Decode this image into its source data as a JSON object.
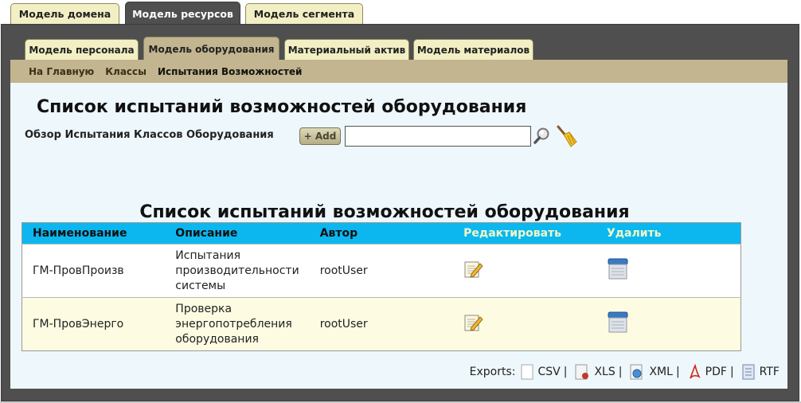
{
  "top_tabs": [
    {
      "label": "Модель домена",
      "active": false
    },
    {
      "label": "Модель ресурсов",
      "active": true
    },
    {
      "label": "Модель сегмента",
      "active": false
    }
  ],
  "sub_tabs": [
    {
      "label": "Модель персонала",
      "active": false
    },
    {
      "label": "Модель оборудования",
      "active": true
    },
    {
      "label": "Материальный актив",
      "active": false
    },
    {
      "label": "Модель материалов",
      "active": false
    }
  ],
  "breadcrumb": [
    "На Главную",
    "Классы",
    "Испытания Возможностей"
  ],
  "page": {
    "heading": "Список испытаний возможностей оборудования",
    "filter_label": "Обзор Испытания Классов Оборудования",
    "add_button": "+ Add",
    "search_value": "",
    "table_title": "Список испытаний возможностей оборудования"
  },
  "table": {
    "headers": [
      "Наименование",
      "Описание",
      "Автор",
      "Редактировать",
      "Удалить"
    ],
    "rows": [
      {
        "name": "ГМ-ПровПроизв",
        "desc1": "Испытания",
        "desc2": "производительности",
        "desc3": "системы",
        "author": "rootUser"
      },
      {
        "name": "ГМ-ПровЭнерго",
        "desc1": "Проверка",
        "desc2": "энергопотребления",
        "desc3": "оборудования",
        "author": "rootUser"
      }
    ]
  },
  "exports": {
    "label": "Exports:",
    "items": [
      "CSV",
      "XLS",
      "XML",
      "PDF",
      "RTF"
    ]
  },
  "colors": {
    "panel": "#4f4f4f",
    "tab": "#f2efc4",
    "crumbbar": "#c2b58f",
    "content": "#eef7fb",
    "table_header": "#0cb7ef",
    "row_even": "#fdfce2"
  }
}
